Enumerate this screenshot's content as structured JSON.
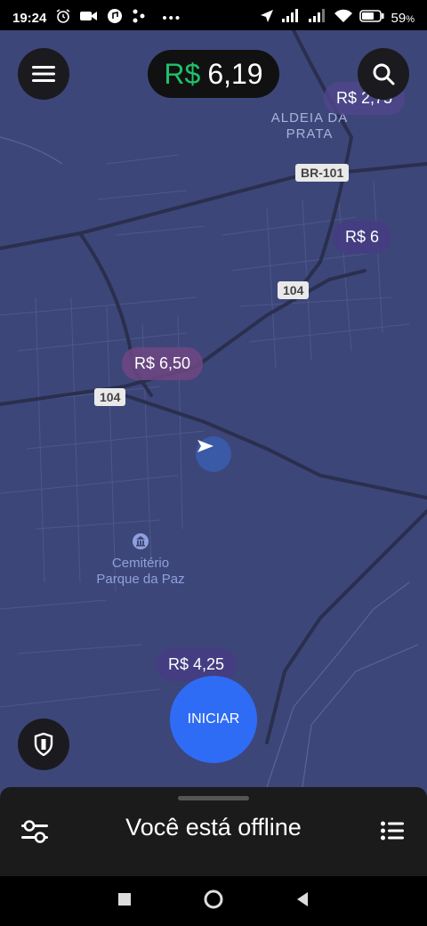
{
  "status_bar": {
    "time": "19:24",
    "battery": "59",
    "battery_unit": "%"
  },
  "map": {
    "places": [
      {
        "line1": "ALDEIA DA",
        "line2": "PRATA"
      },
      {
        "line1": "Cemitério",
        "line2": "Parque da Paz"
      }
    ],
    "roads": [
      "BR-101",
      "104",
      "104"
    ],
    "surge_prices": [
      "R$ 2,75",
      "R$ 6",
      "R$ 6,50",
      "R$ 4,25"
    ]
  },
  "earnings": {
    "currency": "R$",
    "amount": "6,19"
  },
  "start_button": {
    "label": "INICIAR"
  },
  "bottom_sheet": {
    "status": "Você está offline"
  },
  "colors": {
    "map_bg": "#3d4679",
    "accent_blue": "#2f6cf5",
    "money_green": "#1fc16b"
  },
  "icons": [
    "alarm-icon",
    "video-icon",
    "music-icon",
    "location-arrow-icon",
    "signal-icon",
    "wifi-icon",
    "battery-icon",
    "menu-icon",
    "search-icon",
    "shield-icon",
    "filters-icon",
    "list-icon"
  ]
}
